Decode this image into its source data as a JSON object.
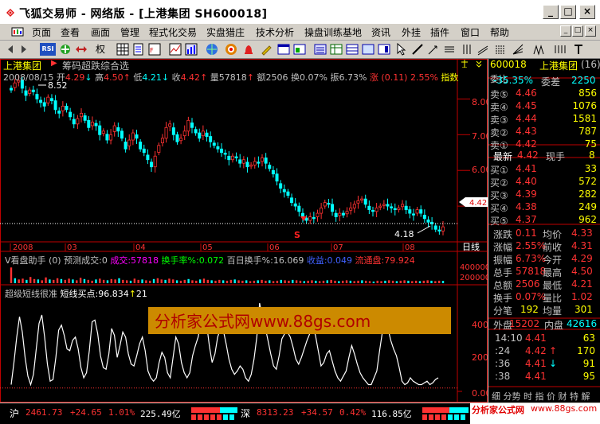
{
  "window": {
    "title": "飞狐交易师 - 网络版 - [上港集团  SH600018]",
    "controls": [
      "_",
      "□",
      "×"
    ]
  },
  "menu": {
    "items": [
      "页面",
      "查看",
      "画面",
      "管理",
      "程式化交易",
      "实盘猎庄",
      "技术分析",
      "操盘训练基地",
      "资讯",
      "外挂",
      "插件",
      "窗口",
      "帮助"
    ]
  },
  "toolbar": {
    "rsi_label": "RSI",
    "quan_label": "权"
  },
  "chart": {
    "stock_name": "上港集团",
    "formula_name": "筹码超跌综合选",
    "info": {
      "date": "2008/08/15",
      "open_label": "开",
      "open": "4.29",
      "open_arrow": "↓",
      "high_label": "高",
      "high": "4.50",
      "high_arrow": "↑",
      "low_label": "低",
      "low": "4.21",
      "low_arrow": "↓",
      "close_label": "收",
      "close": "4.42",
      "close_arrow": "↑",
      "volume": "量57818",
      "volume_arrow": "↑",
      "amount": "额2506",
      "turnover": "换0.07%",
      "amplitude": "振6.73%",
      "change": "涨 (0.11) 2.55%",
      "index_label": "指数"
    },
    "price_axis": [
      "8.00",
      "7.00",
      "6.00",
      "5.00"
    ],
    "price_high_label": "8.52",
    "price_low_label": "4.18",
    "current_price_tag": "4.42",
    "signal_mark": "S",
    "x_axis_labels": [
      "2008",
      "03",
      "04",
      "05",
      "06",
      "07",
      "08"
    ],
    "period_label": "日线",
    "volume_panel": {
      "title": "V看盘助手 (0)",
      "pred_label": "预测成交:0",
      "trade_label": "成交:57818",
      "turnover_label": "换手率%:0.072",
      "avg_turnover_label": "百日换手%:16.069",
      "profit_label": "收益:0.049",
      "float_label": "流通盘:79.924",
      "axis": [
        "400000",
        "200000"
      ]
    },
    "indicator_panel": {
      "title": "超级短线很准",
      "signal_label": "短线买点:96.834",
      "signal_arrow": "↑",
      "signal_value": "21",
      "axis": [
        "400.00",
        "200.00",
        "0.00"
      ],
      "watermark": "分析家公式网www.88gs.com"
    }
  },
  "chart_data": [
    {
      "type": "candlestick",
      "title": "",
      "x_labels": [
        "2008",
        "03",
        "04",
        "05",
        "06",
        "07",
        "08"
      ],
      "ylim": [
        4.0,
        8.9
      ],
      "high_mark": 8.52,
      "low_mark": 4.18,
      "last_close": 4.42,
      "closes": [
        8.25,
        8.45,
        8.52,
        8.3,
        8.1,
        8.25,
        8.2,
        8.0,
        7.9,
        7.8,
        8.05,
        7.95,
        7.7,
        7.6,
        7.8,
        7.7,
        7.5,
        7.3,
        7.45,
        7.6,
        7.4,
        7.2,
        7.35,
        7.25,
        7.0,
        7.1,
        6.85,
        7.0,
        7.25,
        7.1,
        6.9,
        6.6,
        6.85,
        7.05,
        6.9,
        6.6,
        6.5,
        6.3,
        6.1,
        6.4,
        6.7,
        6.9,
        7.2,
        7.3,
        7.0,
        6.8,
        6.9,
        7.1,
        7.4,
        7.2,
        7.05,
        6.9,
        7.1,
        6.95,
        6.8,
        6.7,
        6.6,
        6.5,
        6.45,
        6.3,
        6.4,
        6.35,
        6.2,
        6.3,
        6.1,
        6.15,
        6.25,
        6.2,
        6.35,
        6.2,
        6.05,
        5.9,
        5.7,
        5.5,
        5.4,
        5.3,
        5.1,
        5.0,
        4.85,
        4.7,
        4.6,
        4.7,
        4.65,
        4.8,
        4.95,
        5.1,
        5.05,
        4.85,
        4.7,
        4.8,
        4.75,
        4.85,
        4.95,
        5.05,
        5.15,
        5.2,
        5.05,
        4.9,
        4.85,
        4.95,
        5.0,
        5.05,
        5.0,
        4.95,
        4.9,
        4.95,
        5.05,
        4.9,
        4.8,
        4.75,
        4.9,
        4.8,
        4.65,
        4.55,
        4.5,
        4.35,
        4.3,
        4.42
      ]
    },
    {
      "type": "bar",
      "title": "",
      "name": "",
      "ylim": [
        0,
        500000
      ],
      "values": [
        380000,
        120000,
        90000,
        110000,
        80000,
        150000,
        100000,
        90000,
        70000,
        140000,
        90000,
        80000,
        120000,
        100000,
        80000,
        110000,
        90000,
        70000,
        130000,
        100000,
        80000,
        60000,
        90000,
        110000,
        80000,
        70000,
        100000,
        90000,
        120000,
        80000,
        70000,
        60000,
        110000,
        80000,
        90000,
        70000,
        60000,
        100000,
        120000,
        90000,
        80000,
        110000,
        90000,
        70000,
        60000,
        80000,
        100000,
        70000,
        60000,
        90000,
        110000,
        80000,
        70000,
        60000,
        80000,
        70000,
        60000,
        80000,
        90000,
        70000,
        60000,
        70000,
        50000,
        60000,
        70000,
        80000,
        60000,
        70000,
        50000,
        60000,
        80000,
        70000,
        60000,
        80000,
        70000,
        60000,
        50000,
        60000,
        70000,
        60000,
        50000,
        60000,
        70000,
        80000,
        60000,
        50000,
        60000,
        70000,
        60000,
        50000,
        60000,
        70000,
        60000,
        50000,
        40000,
        60000,
        50000,
        60000,
        70000,
        60000,
        50000,
        60000,
        70000,
        60000,
        50000,
        60000,
        50000,
        60000,
        70000,
        60000,
        50000,
        60000,
        57818
      ]
    },
    {
      "type": "line",
      "title": "",
      "name": "短线买点",
      "ylim": [
        -20,
        540
      ],
      "values": [
        20,
        150,
        300,
        420,
        330,
        180,
        70,
        20,
        80,
        230,
        380,
        430,
        300,
        140,
        40,
        50,
        180,
        340,
        370,
        310,
        230,
        220,
        280,
        300,
        230,
        120,
        60,
        90,
        220,
        390,
        400,
        320,
        190,
        120,
        110,
        200,
        350,
        310,
        180,
        250,
        330,
        300,
        200,
        140,
        130,
        190,
        260,
        300,
        220,
        100,
        60,
        40,
        60,
        150,
        210,
        180,
        90,
        60,
        180,
        300,
        260,
        150,
        90,
        60,
        90,
        190,
        250,
        300,
        390,
        430,
        380,
        250,
        150,
        200,
        300,
        350,
        340,
        260,
        170,
        110,
        80,
        100,
        130,
        110,
        60,
        40,
        80,
        170,
        300,
        500,
        420,
        360,
        280,
        200,
        130,
        110,
        190,
        290,
        320,
        330,
        300,
        240,
        170,
        140,
        180,
        230,
        280,
        320,
        360,
        310,
        220,
        130,
        150,
        200,
        220,
        160,
        100,
        60,
        40,
        70,
        100,
        180,
        250,
        200,
        140,
        90,
        60,
        40,
        20,
        20,
        60,
        100,
        220,
        330,
        380,
        350,
        280,
        230,
        190,
        120,
        40,
        20,
        30,
        60,
        40,
        30,
        20,
        20,
        30,
        40,
        20,
        30,
        50,
        60
      ]
    }
  ],
  "quote": {
    "code": "600018",
    "name": "上港集团",
    "index": "(16)",
    "weibi_label": "委比",
    "weibi": "-35.35%",
    "weicha_label": "委差",
    "weicha": "2250",
    "asks": [
      {
        "label": "卖⑤",
        "price": "4.46",
        "vol": "856"
      },
      {
        "label": "卖④",
        "price": "4.45",
        "vol": "1076"
      },
      {
        "label": "卖③",
        "price": "4.44",
        "vol": "1581"
      },
      {
        "label": "卖②",
        "price": "4.43",
        "vol": "787"
      },
      {
        "label": "卖①",
        "price": "4.42",
        "vol": "75"
      }
    ],
    "latest_label": "最新",
    "latest": "4.42",
    "xianshou_label": "现手",
    "xianshou": "8",
    "bids": [
      {
        "label": "买①",
        "price": "4.41",
        "vol": "33"
      },
      {
        "label": "买②",
        "price": "4.40",
        "vol": "572"
      },
      {
        "label": "买③",
        "price": "4.39",
        "vol": "282"
      },
      {
        "label": "买④",
        "price": "4.38",
        "vol": "249"
      },
      {
        "label": "买⑤",
        "price": "4.37",
        "vol": "962"
      }
    ],
    "stats": [
      {
        "l1": "涨跌",
        "v1": "0.11",
        "l2": "均价",
        "v2": "4.33"
      },
      {
        "l1": "涨幅",
        "v1": "2.55%",
        "l2": "前收",
        "v2": "4.31"
      },
      {
        "l1": "振幅",
        "v1": "6.73%",
        "l2": "今开",
        "v2": "4.29"
      },
      {
        "l1": "总手",
        "v1": "57818",
        "l2": "最高",
        "v2": "4.50"
      },
      {
        "l1": "总额",
        "v1": "2506",
        "l2": "最低",
        "v2": "4.21"
      },
      {
        "l1": "换手",
        "v1": "0.07%",
        "l2": "量比",
        "v2": "1.02"
      }
    ],
    "fenbi_label": "分笔",
    "fenbi": "192",
    "junliang_label": "均量",
    "junliang": "301",
    "waipan_label": "外盘",
    "waipan": "15202",
    "neipan_label": "内盘",
    "neipan": "42616",
    "ticks": [
      {
        "time": "14:10",
        "price": "4.41",
        "arrow": "",
        "vol": "63"
      },
      {
        "time": ":24",
        "price": "4.42",
        "arrow": "↑",
        "vol": "170"
      },
      {
        "time": ":36",
        "price": "4.41",
        "arrow": "↓",
        "vol": "91"
      },
      {
        "time": ":38",
        "price": "4.41",
        "arrow": "",
        "vol": "95"
      }
    ],
    "tabs_label": "细  分势  时  指  价  财  特  解"
  },
  "status": {
    "sh_label": "沪",
    "sh_index": "2461.73",
    "sh_change": "+24.65",
    "sh_pct": "1.01%",
    "sh_amount": "225.49亿",
    "sz_label": "深",
    "sz_index": "8313.23",
    "sz_change": "+34.57",
    "sz_pct": "0.42%",
    "sz_amount": "116.85亿",
    "ad_label": "分析家公式网",
    "ad_url": "www.88gs.com"
  },
  "colors": {
    "up": "#ff3232",
    "down": "#00ffff",
    "flat": "#ffffff",
    "axis": "#c00000",
    "yellow": "#ffff00",
    "green": "#00ff00",
    "magenta": "#ff00ff",
    "watermark_bg": "#cc8a00",
    "watermark_text": "#b00000"
  }
}
